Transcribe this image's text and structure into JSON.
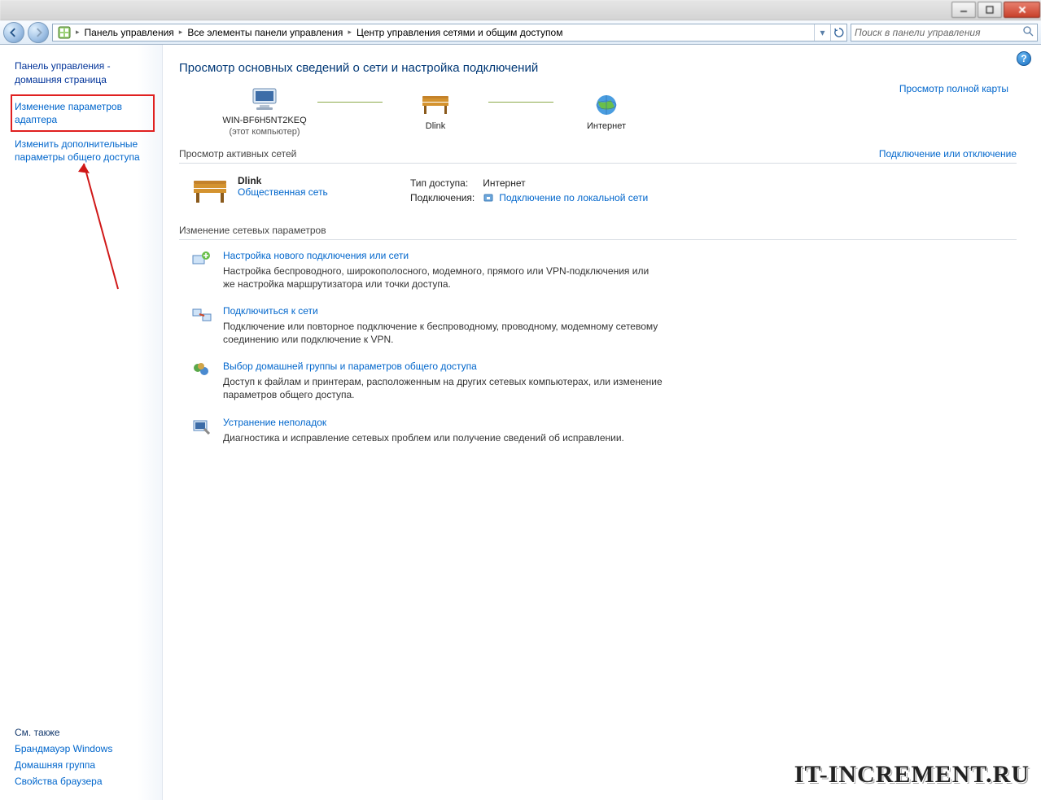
{
  "window": {
    "minimize": "–",
    "maximize": "🗖",
    "close": "✕"
  },
  "breadcrumb": {
    "seg1": "Панель управления",
    "seg2": "Все элементы панели управления",
    "seg3": "Центр управления сетями и общим доступом"
  },
  "search": {
    "placeholder": "Поиск в панели управления"
  },
  "sidebar": {
    "home_line1": "Панель управления -",
    "home_line2": "домашняя страница",
    "link_adapter": "Изменение параметров адаптера",
    "link_sharing": "Изменить дополнительные параметры общего доступа",
    "seealso_hdr": "См. также",
    "seealso1": "Брандмауэр Windows",
    "seealso2": "Домашняя группа",
    "seealso3": "Свойства браузера"
  },
  "page": {
    "title": "Просмотр основных сведений о сети и настройка подключений",
    "map_full_link": "Просмотр полной карты",
    "node1": "WIN-BF6H5NT2KEQ",
    "node1_sub": "(этот компьютер)",
    "node2": "Dlink",
    "node3": "Интернет",
    "active_hdr": "Просмотр активных сетей",
    "active_link": "Подключение или отключение",
    "net_name": "Dlink",
    "net_type": "Общественная сеть",
    "prop_access_lbl": "Тип доступа:",
    "prop_access_val": "Интернет",
    "prop_conn_lbl": "Подключения:",
    "prop_conn_val": "Подключение по локальной сети",
    "change_hdr": "Изменение сетевых параметров",
    "tasks": [
      {
        "title": "Настройка нового подключения или сети",
        "desc": "Настройка беспроводного, широкополосного, модемного, прямого или VPN-подключения или же настройка маршрутизатора или точки доступа."
      },
      {
        "title": "Подключиться к сети",
        "desc": "Подключение или повторное подключение к беспроводному, проводному, модемному сетевому соединению или подключение к VPN."
      },
      {
        "title": "Выбор домашней группы и параметров общего доступа",
        "desc": "Доступ к файлам и принтерам, расположенным на других сетевых компьютерах, или изменение параметров общего доступа."
      },
      {
        "title": "Устранение неполадок",
        "desc": "Диагностика и исправление сетевых проблем или получение сведений об исправлении."
      }
    ]
  },
  "watermark": "IT-INCREMENT.RU"
}
